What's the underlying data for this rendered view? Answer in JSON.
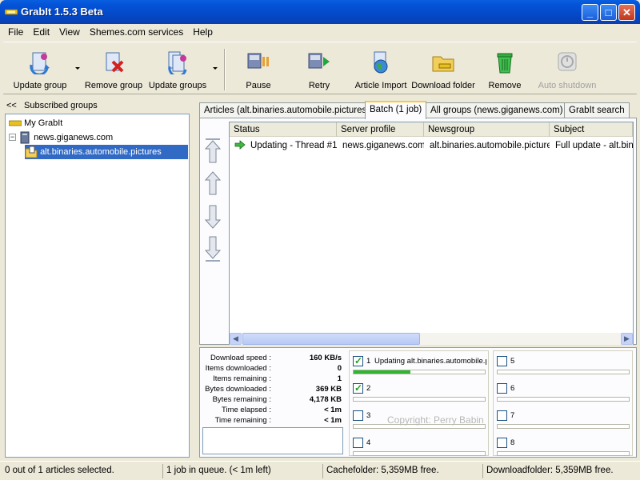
{
  "window": {
    "title": "GrabIt 1.5.3 Beta",
    "min": "_",
    "max": "□",
    "close": "✕"
  },
  "menu": [
    "File",
    "Edit",
    "View",
    "Shemes.com services",
    "Help"
  ],
  "toolbar": {
    "update_group": "Update group",
    "remove_group": "Remove group",
    "update_groups": "Update groups",
    "pause": "Pause",
    "retry": "Retry",
    "article_import": "Article Import",
    "download_folder": "Download folder",
    "remove": "Remove",
    "auto_shutdown": "Auto shutdown"
  },
  "sidebar": {
    "collapse": "<<",
    "heading": "Subscribed groups",
    "tree": {
      "root": "My GrabIt",
      "server": "news.giganews.com",
      "group": "alt.binaries.automobile.pictures"
    }
  },
  "tabs": [
    {
      "label": "Articles (alt.binaries.automobile.pictures)"
    },
    {
      "label": "Batch (1 job)"
    },
    {
      "label": "All groups (news.giganews.com)"
    },
    {
      "label": "GrabIt search"
    }
  ],
  "batch": {
    "columns": [
      "Status",
      "Server profile",
      "Newsgroup",
      "Subject"
    ],
    "rows": [
      {
        "status": "Updating - Thread #1",
        "server": "news.giganews.com",
        "newsgroup": "alt.binaries.automobile.pictures",
        "subject": "Full update - alt.binaries.automobile.pictures"
      }
    ]
  },
  "stats": [
    {
      "k": "Download speed :",
      "v": "160 KB/s"
    },
    {
      "k": "Items downloaded :",
      "v": "0"
    },
    {
      "k": "Items remaining :",
      "v": "1"
    },
    {
      "k": "Bytes downloaded :",
      "v": "369 KB"
    },
    {
      "k": "Bytes remaining :",
      "v": "4,178 KB"
    },
    {
      "k": "Time elapsed :",
      "v": "< 1m"
    },
    {
      "k": "Time remaining :",
      "v": "< 1m"
    }
  ],
  "threads": [
    {
      "num": "1",
      "text": "Updating alt.binaries.automobile.pictures",
      "checked": true,
      "progress": 0.43
    },
    {
      "num": "2",
      "text": "",
      "checked": true,
      "progress": 0
    },
    {
      "num": "3",
      "text": "",
      "checked": false,
      "progress": 0
    },
    {
      "num": "4",
      "text": "",
      "checked": false,
      "progress": 0
    },
    {
      "num": "5",
      "text": "",
      "checked": false,
      "progress": 0
    },
    {
      "num": "6",
      "text": "",
      "checked": false,
      "progress": 0
    },
    {
      "num": "7",
      "text": "",
      "checked": false,
      "progress": 0
    },
    {
      "num": "8",
      "text": "",
      "checked": false,
      "progress": 0
    }
  ],
  "watermark": "Copyright: Perry Babin",
  "status": {
    "selection": "0 out of 1 articles selected.",
    "queue": "1 job in queue. (< 1m left)",
    "cache": "Cachefolder: 5,359MB free.",
    "download": "Downloadfolder: 5,359MB free."
  },
  "colors": {
    "title_bar": "#0453d8",
    "selection": "#316ac5",
    "active_tab": "#ffc73c",
    "progress": "#2fb52f"
  }
}
